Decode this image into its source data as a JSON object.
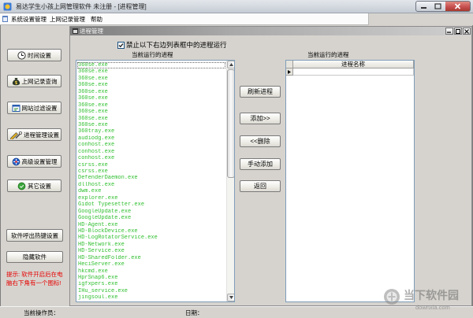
{
  "window": {
    "title": "易达学生小孩上网管理软件 未注册 - [进程管理]"
  },
  "menu": {
    "items": [
      "系统设置管理",
      "上网记录管理",
      "帮助"
    ]
  },
  "sidebar": {
    "items": [
      {
        "label": "时间设置",
        "icon": "clock-icon"
      },
      {
        "label": "上网记录查询",
        "icon": "money-bag-icon"
      },
      {
        "label": "网站过滤设置",
        "icon": "web-filter-icon"
      },
      {
        "label": "进程管理设置",
        "icon": "process-tools-icon"
      },
      {
        "label": "高级设置管理",
        "icon": "advanced-settings-icon"
      },
      {
        "label": "其它设置",
        "icon": "other-settings-icon"
      }
    ],
    "hotkey_button": "软件呼出热键设置",
    "hide_button": "隐藏软件",
    "tip": "提示: 软件开启后在电脑右下角有一个图标!"
  },
  "child_window": {
    "title": "进程管理"
  },
  "process_panel": {
    "block_checkbox": {
      "label": "禁止以下右边列表框中的进程运行",
      "checked": true
    },
    "running_label": "当前运行的进程",
    "running_processes": [
      "360se.exe",
      "360se.exe",
      "360se.exe",
      "360se.exe",
      "360se.exe",
      "360se.exe",
      "360se.exe",
      "360se.exe",
      "360se.exe",
      "360se.exe",
      "360tray.exe",
      "audiodg.exe",
      "conhost.exe",
      "conhost.exe",
      "conhost.exe",
      "csrss.exe",
      "csrss.exe",
      "DefenderDaemon.exe",
      "dllhost.exe",
      "dwm.exe",
      "explorer.exe",
      "Gidot Typesetter.exe",
      "GoogleUpdate.exe",
      "GoogleUpdate.exe",
      "HD-Agent.exe",
      "HD-BlockDevice.exe",
      "HD-LogRotatorService.exe",
      "HD-Network.exe",
      "HD-Service.exe",
      "HD-SharedFolder.exe",
      "HeciServer.exe",
      "hkcmd.exe",
      "HprSnap6.exe",
      "igfxpers.exe",
      "IHu_service.exe",
      "jingsoul.exe"
    ],
    "buttons": {
      "refresh": "刷新进程",
      "add": "添加>>",
      "remove": "<<删除",
      "manual_add": "手动添加",
      "back": "返回"
    },
    "blocked_label": "当前运行的进程",
    "blocked_grid": {
      "column_header": "进程名称",
      "rows": []
    }
  },
  "statusbar": {
    "operator_label": "当前操作员：",
    "date_label": "日期："
  },
  "watermark": {
    "name": "当下软件园",
    "site": "downxia.com"
  },
  "colors": {
    "window_bg": "#d6d3ce",
    "process_list_text": "#2fbf2f",
    "tip_text": "#e60000",
    "close_button": "#c75050"
  }
}
